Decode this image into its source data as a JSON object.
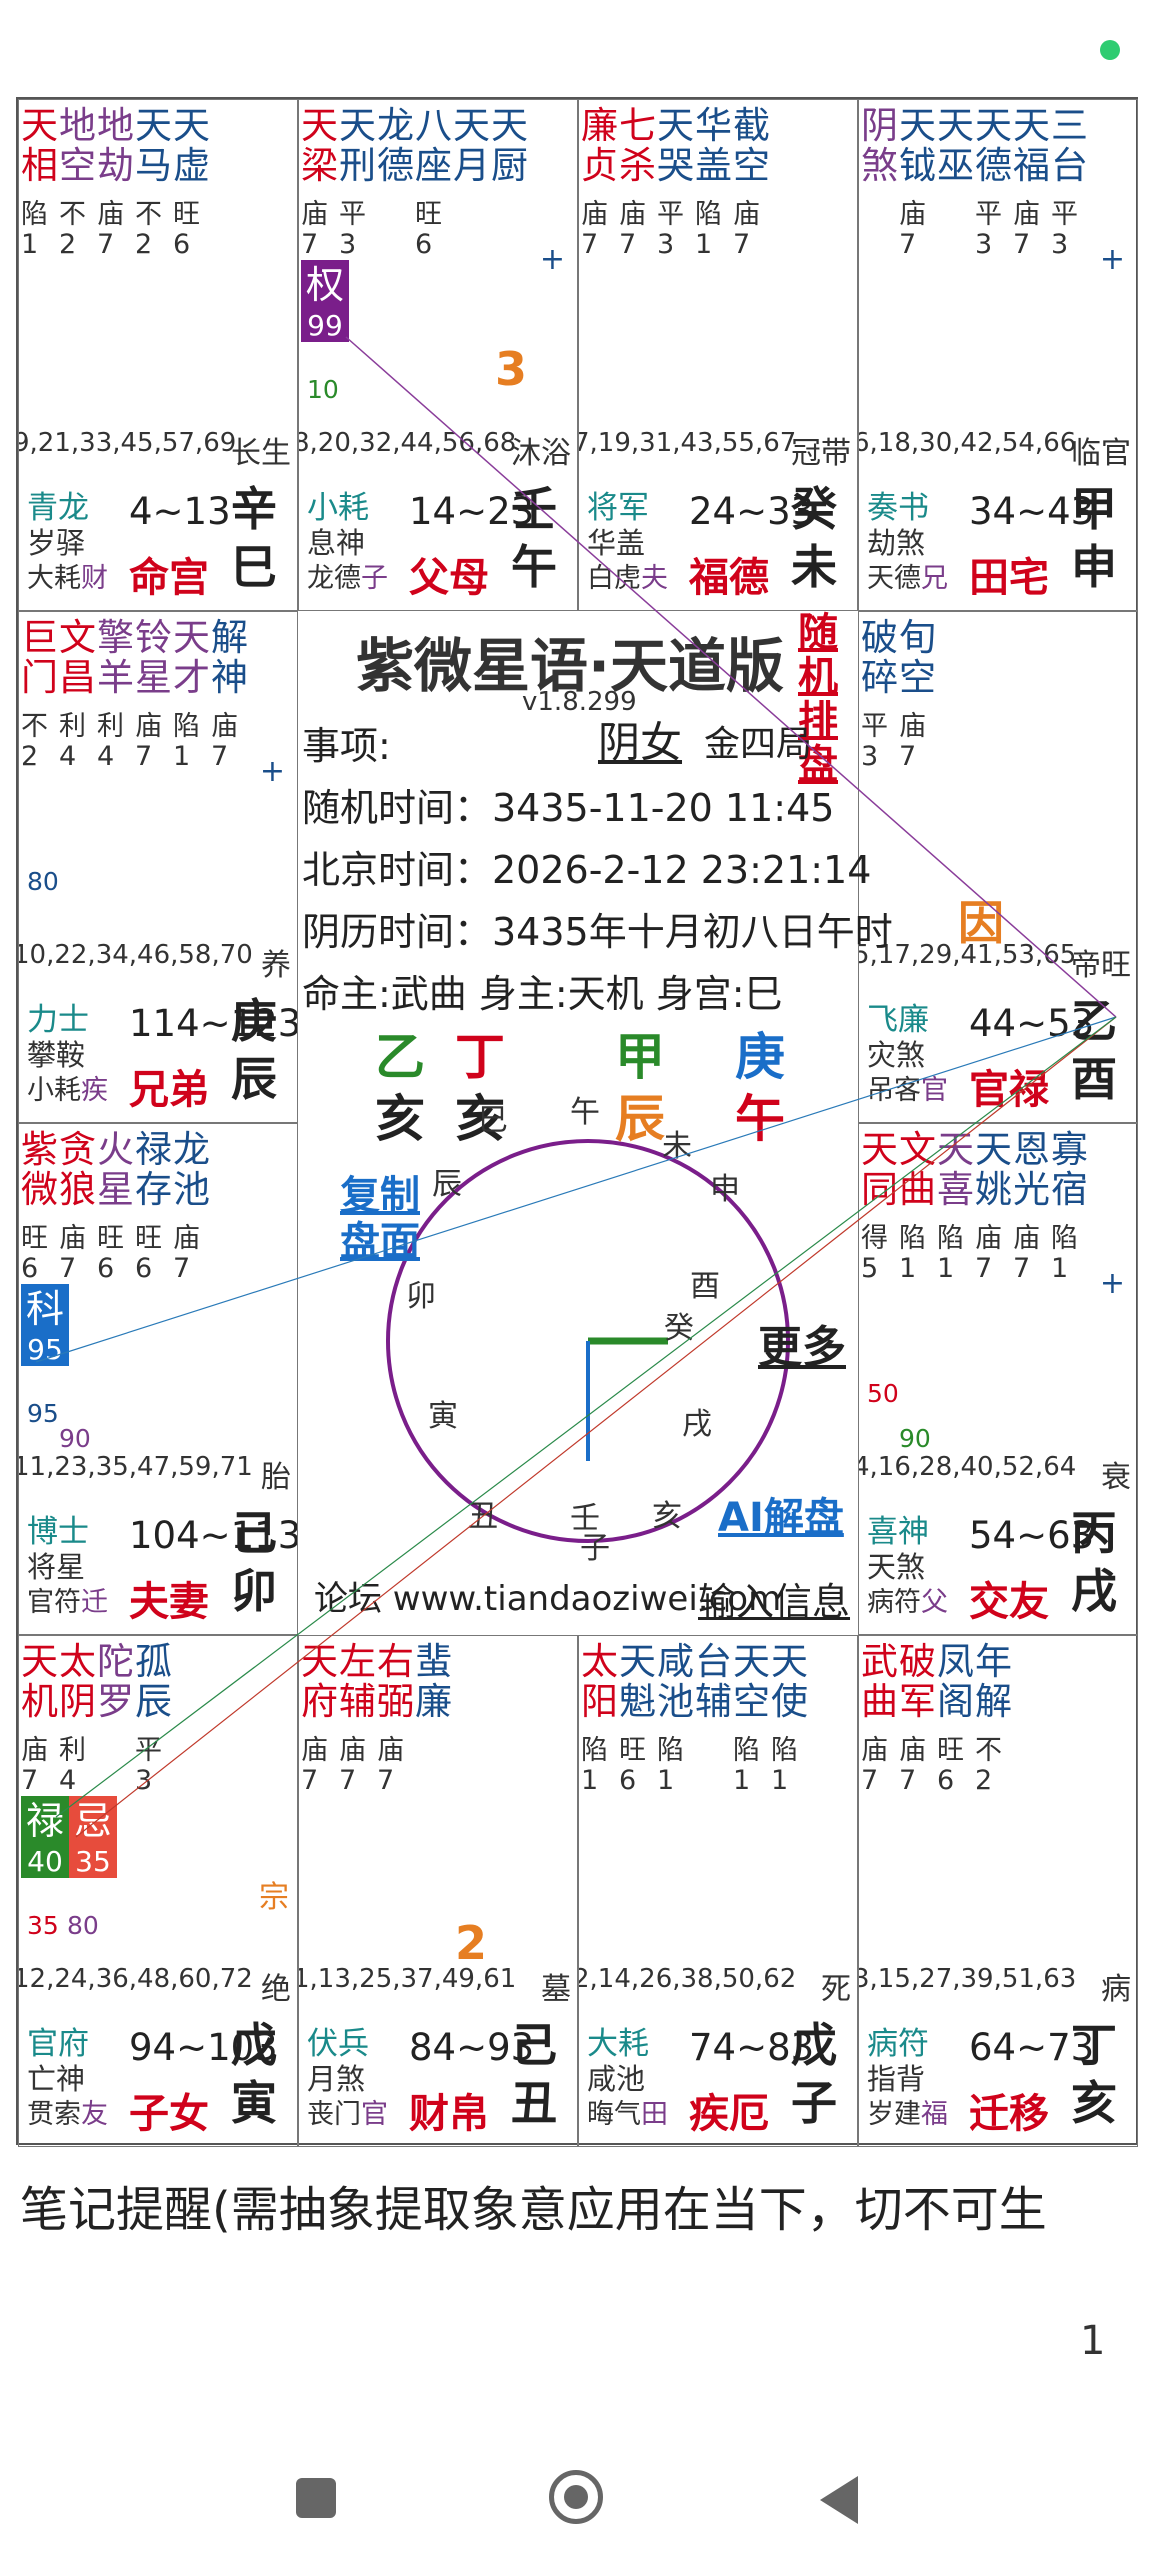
{
  "colors": {
    "red": "#d0021b",
    "blue": "#1a4e8a",
    "purple": "#7a3d8a",
    "teal": "#1a8a8a",
    "green": "#2a8a2a",
    "orange": "#e67e22"
  },
  "cells": [
    {
      "id": "si",
      "stars": [
        [
          "天",
          "相"
        ],
        [
          "地",
          "空"
        ],
        [
          "地",
          "劫"
        ],
        [
          "天",
          "马"
        ],
        [
          "天",
          "虚"
        ]
      ],
      "colors": [
        "red",
        "purple",
        "purple",
        "blue",
        "blue"
      ],
      "bright": [
        "陷\n1",
        "不\n2",
        "庙\n7",
        "不\n2",
        "旺\n6"
      ],
      "ages": "9,21,33,45,57,69",
      "stage": "长生",
      "minA": "青龙",
      "minB": "岁驿",
      "minC": "大耗",
      "minCx": "财",
      "range": "4~13",
      "palace": "命宫",
      "stem": "辛",
      "branch": "巳"
    },
    {
      "id": "wu",
      "stars": [
        [
          "天",
          "梁"
        ],
        [
          "天",
          "刑"
        ],
        [
          "龙",
          "德"
        ],
        [
          "八",
          "座"
        ],
        [
          "天",
          "月"
        ],
        [
          "天",
          "厨"
        ]
      ],
      "colors": [
        "red",
        "blue",
        "blue",
        "blue",
        "blue",
        "blue"
      ],
      "bright": [
        "庙\n7",
        "平\n3",
        "",
        "旺\n6",
        "",
        ""
      ],
      "ages": "8,20,32,44,56,68",
      "stage": "沐浴",
      "minA": "小耗",
      "minB": "息神",
      "minC": "龙德",
      "minCx": "子",
      "range": "14~23",
      "palace": "父母",
      "stem": "壬",
      "branch": "午",
      "plus": "+",
      "badge": {
        "t": "权",
        "n": "99",
        "c": "#7a1e8a"
      },
      "note1": "10",
      "bignum": "3"
    },
    {
      "id": "wei",
      "stars": [
        [
          "廉",
          "贞"
        ],
        [
          "七",
          "杀"
        ],
        [
          "天",
          "哭"
        ],
        [
          "华",
          "盖"
        ],
        [
          "截",
          "空"
        ]
      ],
      "colors": [
        "red",
        "red",
        "blue",
        "blue",
        "blue"
      ],
      "bright": [
        "庙\n7",
        "庙\n7",
        "平\n3",
        "陷\n1",
        "庙\n7"
      ],
      "ages": "7,19,31,43,55,67",
      "stage": "冠带",
      "minA": "将军",
      "minB": "华盖",
      "minC": "白虎",
      "minCx": "夫",
      "range": "24~33",
      "palace": "福德",
      "stem": "癸",
      "branch": "未"
    },
    {
      "id": "shen",
      "stars": [
        [
          "阴",
          "煞"
        ],
        [
          "天",
          "钺"
        ],
        [
          "天",
          "巫"
        ],
        [
          "天",
          "德"
        ],
        [
          "天",
          "福"
        ],
        [
          "三",
          "台"
        ]
      ],
      "colors": [
        "purple",
        "blue",
        "blue",
        "blue",
        "blue",
        "blue"
      ],
      "bright": [
        "",
        "庙\n7",
        "",
        "平\n3",
        "庙\n7",
        "平\n3"
      ],
      "ages": "6,18,30,42,54,66",
      "stage": "临官",
      "minA": "奏书",
      "minB": "劫煞",
      "minC": "天德",
      "minCx": "兄",
      "range": "34~43",
      "palace": "田宅",
      "stem": "甲",
      "branch": "申",
      "plus": "+"
    },
    {
      "id": "chen",
      "stars": [
        [
          "巨",
          "门"
        ],
        [
          "文",
          "昌"
        ],
        [
          "擎",
          "羊"
        ],
        [
          "铃",
          "星"
        ],
        [
          "天",
          "才"
        ],
        [
          "解",
          "神"
        ]
      ],
      "colors": [
        "red",
        "red",
        "purple",
        "purple",
        "purple",
        "blue"
      ],
      "bright": [
        "不\n2",
        "利\n4",
        "利\n4",
        "庙\n7",
        "陷\n1",
        "庙\n7"
      ],
      "ages": "10,22,34,46,58,70",
      "stage": "养",
      "minA": "力士",
      "minB": "攀鞍",
      "minC": "小耗",
      "minCx": "疾",
      "range": "114~123",
      "palace": "兄弟",
      "stem": "庚",
      "branch": "辰",
      "plus": "+",
      "note1": "80"
    },
    {
      "id": "you",
      "stars": [
        [
          "破",
          "碎"
        ],
        [
          "旬",
          "空"
        ]
      ],
      "colors": [
        "blue",
        "blue"
      ],
      "bright": [
        "平\n3",
        "庙\n7"
      ],
      "ages": "5,17,29,41,53,65",
      "stage": "帝旺",
      "minA": "飞廉",
      "minB": "灾煞",
      "minC": "吊客",
      "minCx": "官",
      "range": "44~53",
      "palace": "官禄",
      "stem": "乙",
      "branch": "酉"
    },
    {
      "id": "mao",
      "stars": [
        [
          "紫",
          "微"
        ],
        [
          "贪",
          "狼"
        ],
        [
          "火",
          "星"
        ],
        [
          "禄",
          "存"
        ],
        [
          "龙",
          "池"
        ]
      ],
      "colors": [
        "red",
        "red",
        "purple",
        "blue",
        "blue"
      ],
      "bright": [
        "旺\n6",
        "庙\n7",
        "旺\n6",
        "旺\n6",
        "庙\n7"
      ],
      "ages": "11,23,35,47,59,71",
      "stage": "胎",
      "minA": "博士",
      "minB": "将星",
      "minC": "官符",
      "minCx": "迁",
      "range": "104~113",
      "palace": "夫妻",
      "stem": "己",
      "branch": "卯",
      "badge": {
        "t": "科",
        "n": "95",
        "c": "#1a6ec8"
      },
      "note1": "95",
      "note2": "90"
    },
    {
      "id": "xu",
      "stars": [
        [
          "天",
          "同"
        ],
        [
          "文",
          "曲"
        ],
        [
          "天",
          "喜"
        ],
        [
          "天",
          "姚"
        ],
        [
          "恩",
          "光"
        ],
        [
          "寡",
          "宿"
        ]
      ],
      "colors": [
        "red",
        "red",
        "purple",
        "blue",
        "blue",
        "blue"
      ],
      "bright": [
        "得\n5",
        "陷\n1",
        "陷\n1",
        "庙\n7",
        "庙\n7",
        "陷\n1"
      ],
      "ages": "4,16,28,40,52,64",
      "stage": "衰",
      "minA": "喜神",
      "minB": "天煞",
      "minC": "病符",
      "minCx": "父",
      "range": "54~63",
      "palace": "交友",
      "stem": "丙",
      "branch": "戌",
      "plus": "+",
      "note1": "50",
      "note2": "90"
    },
    {
      "id": "yin",
      "stars": [
        [
          "天",
          "机"
        ],
        [
          "太",
          "阴"
        ],
        [
          "陀",
          "罗"
        ],
        [
          "孤",
          "辰"
        ]
      ],
      "colors": [
        "red",
        "red",
        "purple",
        "blue"
      ],
      "bright": [
        "庙\n7",
        "利\n4",
        "",
        "平\n3"
      ],
      "ages": "12,24,36,48,60,72",
      "stage": "绝",
      "minA": "官府",
      "minB": "亡神",
      "minC": "贯索",
      "minCx": "友",
      "range": "94~103",
      "palace": "子女",
      "stem": "戊",
      "branch": "寅",
      "badge2": true,
      "zong": "宗",
      "note1": "35",
      "note2": "80"
    },
    {
      "id": "chou",
      "stars": [
        [
          "天",
          "府"
        ],
        [
          "左",
          "辅"
        ],
        [
          "右",
          "弼"
        ],
        [
          "蜚",
          "廉"
        ]
      ],
      "colors": [
        "red",
        "red",
        "red",
        "blue"
      ],
      "bright": [
        "庙\n7",
        "庙\n7",
        "庙\n7",
        ""
      ],
      "ages": "1,13,25,37,49,61",
      "stage": "墓",
      "minA": "伏兵",
      "minB": "月煞",
      "minC": "丧门",
      "minCx": "官",
      "range": "84~93",
      "palace": "财帛",
      "stem": "己",
      "branch": "丑",
      "bignum": "2"
    },
    {
      "id": "zi",
      "stars": [
        [
          "太",
          "阳"
        ],
        [
          "天",
          "魁"
        ],
        [
          "咸",
          "池"
        ],
        [
          "台",
          "辅"
        ],
        [
          "天",
          "空"
        ],
        [
          "天",
          "使"
        ]
      ],
      "colors": [
        "red",
        "blue",
        "blue",
        "blue",
        "blue",
        "blue"
      ],
      "bright": [
        "陷\n1",
        "旺\n6",
        "陷\n1",
        "",
        "陷\n1",
        "陷\n1"
      ],
      "ages": "2,14,26,38,50,62",
      "stage": "死",
      "minA": "大耗",
      "minB": "咸池",
      "minC": "晦气",
      "minCx": "田",
      "range": "74~83",
      "palace": "疾厄",
      "stem": "戊",
      "branch": "子"
    },
    {
      "id": "hai",
      "stars": [
        [
          "武",
          "曲"
        ],
        [
          "破",
          "军"
        ],
        [
          "凤",
          "阁"
        ],
        [
          "年",
          "解"
        ]
      ],
      "colors": [
        "red",
        "red",
        "blue",
        "blue"
      ],
      "bright": [
        "庙\n7",
        "庙\n7",
        "旺\n6",
        "不\n2"
      ],
      "ages": "3,15,27,39,51,63",
      "stage": "病",
      "minA": "病符",
      "minB": "指背",
      "minC": "岁建",
      "minCx": "福",
      "range": "64~73",
      "palace": "迁移",
      "stem": "丁",
      "branch": "亥"
    }
  ],
  "center": {
    "title": "紫微星语·天道版",
    "version": "v1.8.299",
    "random_btn_1": "随机",
    "random_btn_2": "排盘",
    "item_label": "事项:",
    "gender": "阴女",
    "ju": "金四局",
    "random_time": "随机时间：3435-11-20 11:45",
    "beijing_time": "北京时间：2026-2-12 23:21:14",
    "lunar_time": "阴历时间：3435年十月初八日午时",
    "yin_char": "因",
    "ming": "命主:武曲 身主:天机 身宫:巳",
    "stems": [
      "乙",
      "丁",
      "甲",
      "庚"
    ],
    "branches": [
      "亥",
      "亥",
      "辰",
      "午"
    ],
    "copy_btn_1": "复制",
    "copy_btn_2": "盘面",
    "more_btn": "更多",
    "ai_btn": "AI解盘",
    "forum": "论坛 www.tiandaoziwei.com",
    "input_info": "输入信息",
    "wheel_labels": [
      "巳",
      "午",
      "未",
      "申",
      "酉",
      "戌",
      "亥",
      "子",
      "丑",
      "寅",
      "卯",
      "辰"
    ],
    "wheel_center": [
      "癸",
      "壬"
    ]
  },
  "note": "笔记提醒(需抽象提取象意应用在当下，切不可生",
  "page_number": "1"
}
